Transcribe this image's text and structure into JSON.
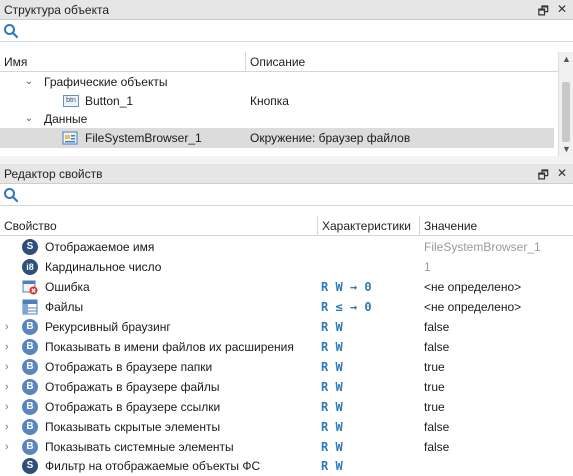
{
  "structure_panel": {
    "title": "Структура объекта",
    "columns": {
      "name": "Имя",
      "description": "Описание"
    },
    "items": [
      {
        "label": "Графические объекты",
        "description": ""
      },
      {
        "label": "Button_1",
        "description": "Кнопка",
        "icon_text": "btn"
      },
      {
        "label": "Данные",
        "description": ""
      },
      {
        "label": "FileSystemBrowser_1",
        "description": "Окружение: браузер файлов"
      }
    ]
  },
  "properties_panel": {
    "title": "Редактор свойств",
    "columns": {
      "property": "Свойство",
      "characteristics": "Характеристики",
      "value": "Значение"
    },
    "rows": [
      {
        "name": "Отображаемое имя",
        "icon": "S",
        "char": "",
        "value": "FileSystemBrowser_1",
        "value_style": "grey"
      },
      {
        "name": "Кардинальное число",
        "icon": "i8",
        "char": "",
        "value": "1",
        "value_style": "grey"
      },
      {
        "name": "Ошибка",
        "icon": "error-icon",
        "char": "R W → 0",
        "value": "<не определено>",
        "value_style": "normal"
      },
      {
        "name": "Файлы",
        "icon": "table-icon",
        "char": "R ≤ → 0",
        "value": "<не определено>",
        "value_style": "normal"
      },
      {
        "name": "Рекурсивный браузинг",
        "icon": "B",
        "char": "R W",
        "value": "false",
        "value_style": "normal"
      },
      {
        "name": "Показывать в имени файлов их расширения",
        "icon": "B",
        "char": "R W",
        "value": "false",
        "value_style": "normal"
      },
      {
        "name": "Отображать в браузере папки",
        "icon": "B",
        "char": "R W",
        "value": "true",
        "value_style": "normal"
      },
      {
        "name": "Отображать в браузере файлы",
        "icon": "B",
        "char": "R W",
        "value": "true",
        "value_style": "normal"
      },
      {
        "name": "Отображать в браузере ссылки",
        "icon": "B",
        "char": "R W",
        "value": "true",
        "value_style": "normal"
      },
      {
        "name": "Показывать скрытые элементы",
        "icon": "B",
        "char": "R W",
        "value": "false",
        "value_style": "normal"
      },
      {
        "name": "Показывать системные элементы",
        "icon": "B",
        "char": "R W",
        "value": "false",
        "value_style": "normal"
      },
      {
        "name": "Фильтр на отображаемые объекты ФС",
        "icon": "S",
        "char": "R W",
        "value": "",
        "value_style": "normal"
      }
    ]
  },
  "colors": {
    "accent": "#2f79b8",
    "selected_row": "#dcdcdc",
    "header_bg": "#e6e6e6"
  }
}
